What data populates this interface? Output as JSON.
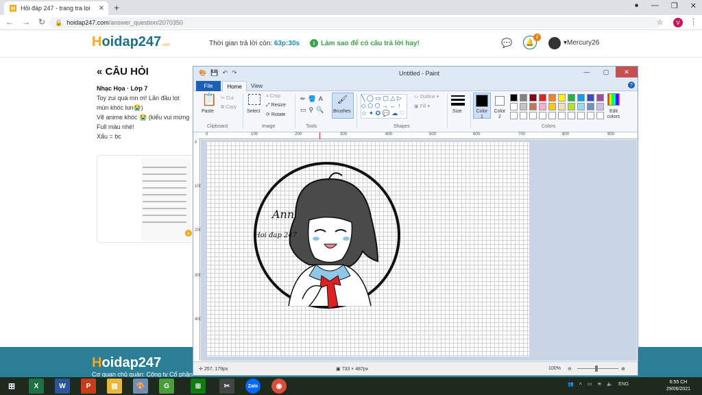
{
  "browser": {
    "tab_title": "Hỏi đáp 247 - trang tra lọi",
    "url_host": "hoidap247.com",
    "url_path": "/answer_question/2070350",
    "profile_initial": "V"
  },
  "site": {
    "logo_text": "oidap247",
    "logo_sub": ".com",
    "timer_label": "Thời gian trả lời còn:",
    "timer_value": "63p:30s",
    "hint_text": "Làm sao để có câu trả lời hay!",
    "notification_count": "2",
    "username": "Mercury26"
  },
  "question": {
    "heading": "« CÂU HỎI",
    "subject": "Nhạc Họa · Lớp 7",
    "lines": [
      "Toy zui quá mn ơi! Lần đầu lọt",
      "mún khóc lun😭)",
      "Vẽ anime khóc 😭 (kiểu vui mừng",
      "Full màu nhé!",
      "Xấu = bc"
    ]
  },
  "footer": {
    "logo_text": "oidap247",
    "text": "Cơ quan chủ quản: Công ty Cổ phần"
  },
  "paint": {
    "title": "Untitled - Paint",
    "tabs": [
      "File",
      "Home",
      "View"
    ],
    "clipboard": {
      "paste": "Paste",
      "cut": "Cut",
      "copy": "Copy",
      "label": "Clipboard"
    },
    "image": {
      "select": "Select",
      "crop": "Crop",
      "resize": "Resize",
      "rotate": "Rotate",
      "label": "Image"
    },
    "tools_label": "Tools",
    "brushes": "Brushes",
    "shapes": {
      "outline": "Outline",
      "fill": "Fill",
      "label": "Shapes"
    },
    "size": "Size",
    "color1": "Color 1",
    "color2": "Color 2",
    "colors_label": "Colors",
    "edit_colors": "Edit colors",
    "palette": [
      "#000000",
      "#7f7f7f",
      "#880015",
      "#ed1c24",
      "#ff7f27",
      "#fff200",
      "#22b14c",
      "#00a2e8",
      "#3f48cc",
      "#a349a4",
      "#ffffff",
      "#c3c3c3",
      "#b97a57",
      "#ffaec9",
      "#ffc90e",
      "#efe4b0",
      "#b5e61d",
      "#99d9ea",
      "#7092be",
      "#c8bfe7",
      "#ffffff",
      "#ffffff",
      "#ffffff",
      "#ffffff",
      "#ffffff",
      "#ffffff",
      "#ffffff",
      "#ffffff",
      "#ffffff",
      "#ffffff"
    ],
    "ruler_h": [
      "0",
      "100",
      "200",
      "300",
      "400",
      "500",
      "600",
      "700",
      "800",
      "900"
    ],
    "ruler_v": [
      "0",
      "100",
      "200",
      "300",
      "400"
    ],
    "drawing_text": [
      "Ann",
      "Hoi đap 247"
    ],
    "status_cursor": "257, 179px",
    "status_size": "733 × 487px",
    "zoom": "100%"
  },
  "taskbar": {
    "lang": "ENG",
    "time": "6:55 CH",
    "date": "29/06/2021"
  }
}
